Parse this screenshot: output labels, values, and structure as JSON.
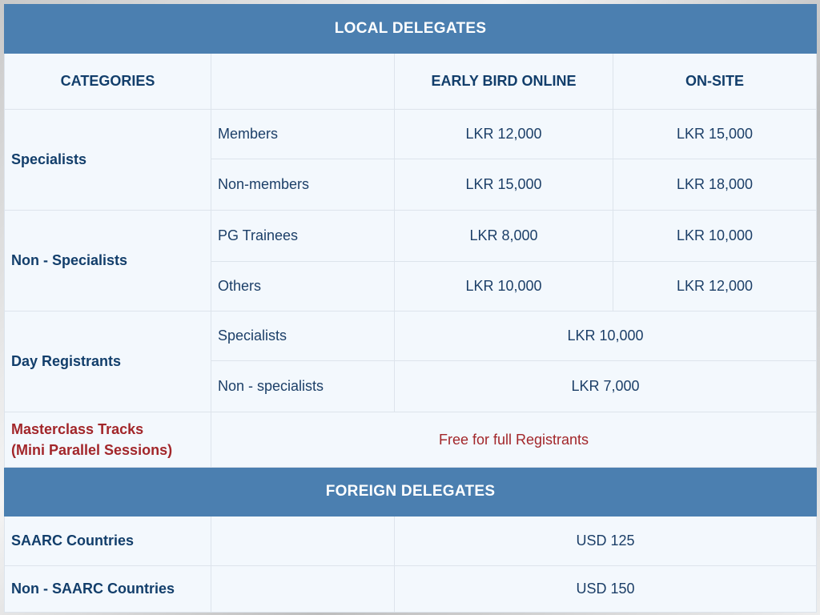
{
  "local": {
    "title": "LOCAL DELEGATES",
    "headers": {
      "categories": "CATEGORIES",
      "blank": "",
      "early_bird": "EARLY BIRD ONLINE",
      "on_site": "ON-SITE"
    },
    "specialists": {
      "label": "Specialists",
      "members": {
        "label": "Members",
        "early": "LKR 12,000",
        "onsite": "LKR 15,000"
      },
      "non_members": {
        "label": "Non-members",
        "early": "LKR 15,000",
        "onsite": "LKR 18,000"
      }
    },
    "non_specialists": {
      "label": "Non - Specialists",
      "pg_trainees": {
        "label": "PG Trainees",
        "early": "LKR 8,000",
        "onsite": "LKR 10,000"
      },
      "others": {
        "label": "Others",
        "early": "LKR 10,000",
        "onsite": "LKR 12,000"
      }
    },
    "day_registrants": {
      "label": "Day Registrants",
      "specialists": {
        "label": "Specialists",
        "fee": "LKR 10,000"
      },
      "non_specialists": {
        "label": "Non - specialists",
        "fee": "LKR 7,000"
      }
    },
    "masterclass": {
      "label_line1": "Masterclass Tracks",
      "label_line2": "(Mini Parallel Sessions)",
      "fee": "Free for full Registrants"
    }
  },
  "foreign": {
    "title": "FOREIGN DELEGATES",
    "saarc": {
      "label": "SAARC Countries",
      "fee": "USD 125"
    },
    "non_saarc": {
      "label": "Non - SAARC Countries",
      "fee": "USD 150"
    }
  },
  "colors": {
    "header_blue": "#4b7fb0",
    "text_navy": "#123e6b",
    "accent_red": "#a2262a",
    "cell_bg": "#f3f8fd"
  }
}
